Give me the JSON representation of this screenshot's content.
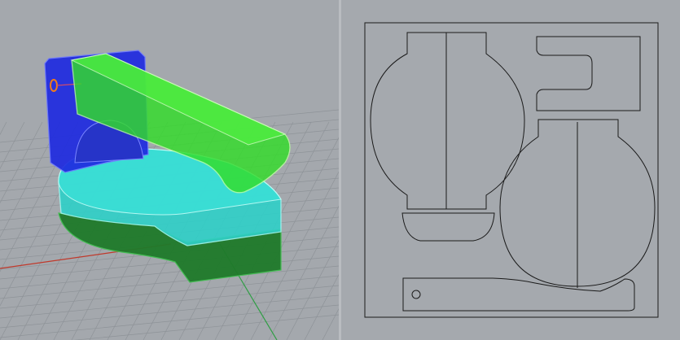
{
  "app": {
    "name": "",
    "viewports": [
      {
        "id": "perspective",
        "kind": "3D perspective view with grid",
        "shading": "ghosted"
      },
      {
        "id": "top",
        "kind": "2D top view of cut-sheet layout"
      }
    ]
  },
  "colors": {
    "background": "#a4a8ad",
    "grid": "#8e9398",
    "blue_part": "#1f2be0",
    "green_part": "#33dd2a",
    "cyan_part": "#2fd0c8",
    "base_part": "#1f7a2a",
    "axis_red": "#c0392b",
    "axis_green": "#2f9e44",
    "outline": "#1a1a1a"
  },
  "icons": {
    "hole": "hole-icon"
  }
}
